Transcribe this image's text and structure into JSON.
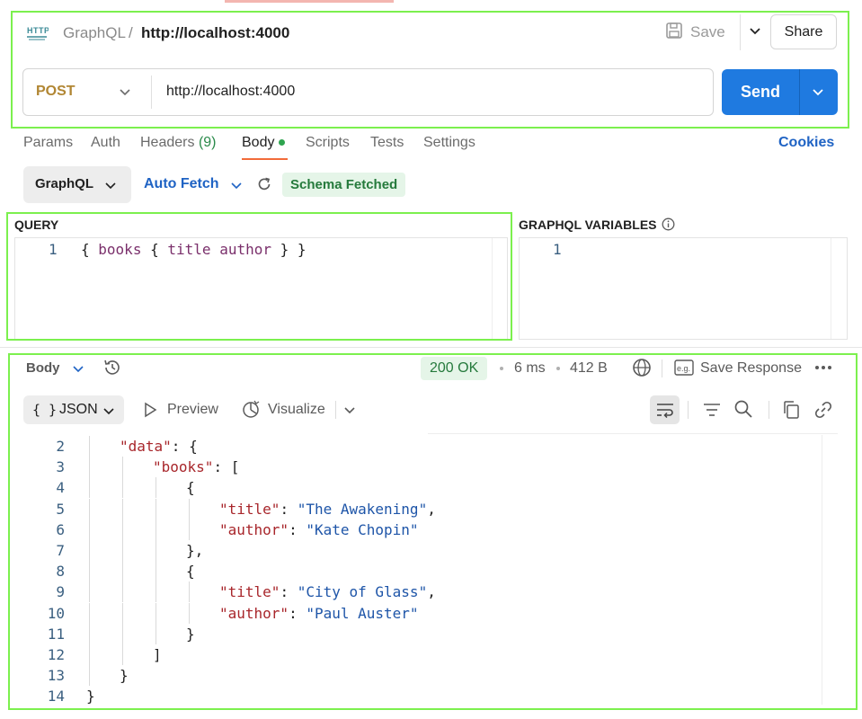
{
  "header": {
    "protocol_badge": "HTTP",
    "breadcrumb_root": "GraphQL",
    "breadcrumb_sep": "/",
    "breadcrumb_current": "http://localhost:4000",
    "save_label": "Save",
    "share_label": "Share"
  },
  "request": {
    "method": "POST",
    "url": "http://localhost:4000",
    "send_label": "Send"
  },
  "tabs": [
    {
      "label": "Params"
    },
    {
      "label": "Auth"
    },
    {
      "label": "Headers",
      "count": "(9)"
    },
    {
      "label": "Body",
      "active": true
    },
    {
      "label": "Scripts"
    },
    {
      "label": "Tests"
    },
    {
      "label": "Settings"
    }
  ],
  "cookies_label": "Cookies",
  "graphql_toolbar": {
    "body_type": "GraphQL",
    "auto_fetch": "Auto Fetch",
    "schema_status": "Schema Fetched"
  },
  "query_pane": {
    "label": "QUERY",
    "line_number": "1",
    "code": "{ books { title author } }"
  },
  "variables_pane": {
    "label": "GRAPHQL VARIABLES",
    "line_number": "1"
  },
  "response": {
    "body_label": "Body",
    "status": "200 OK",
    "time": "6 ms",
    "size": "412 B",
    "save_response": "Save Response",
    "format": "JSON",
    "format_glyph": "{ }",
    "preview_label": "Preview",
    "visualize_label": "Visualize",
    "lines": [
      {
        "n": "2",
        "indent": 1,
        "parts": [
          [
            "key",
            "\"data\""
          ],
          [
            "pun",
            ": {"
          ]
        ]
      },
      {
        "n": "3",
        "indent": 2,
        "parts": [
          [
            "key",
            "\"books\""
          ],
          [
            "pun",
            ": ["
          ]
        ]
      },
      {
        "n": "4",
        "indent": 3,
        "parts": [
          [
            "pun",
            "{"
          ]
        ]
      },
      {
        "n": "5",
        "indent": 4,
        "parts": [
          [
            "key",
            "\"title\""
          ],
          [
            "pun",
            ": "
          ],
          [
            "str",
            "\"The Awakening\""
          ],
          [
            "pun",
            ","
          ]
        ]
      },
      {
        "n": "6",
        "indent": 4,
        "parts": [
          [
            "key",
            "\"author\""
          ],
          [
            "pun",
            ": "
          ],
          [
            "str",
            "\"Kate Chopin\""
          ]
        ]
      },
      {
        "n": "7",
        "indent": 3,
        "parts": [
          [
            "pun",
            "},"
          ]
        ]
      },
      {
        "n": "8",
        "indent": 3,
        "parts": [
          [
            "pun",
            "{"
          ]
        ]
      },
      {
        "n": "9",
        "indent": 4,
        "parts": [
          [
            "key",
            "\"title\""
          ],
          [
            "pun",
            ": "
          ],
          [
            "str",
            "\"City of Glass\""
          ],
          [
            "pun",
            ","
          ]
        ]
      },
      {
        "n": "10",
        "indent": 4,
        "parts": [
          [
            "key",
            "\"author\""
          ],
          [
            "pun",
            ": "
          ],
          [
            "str",
            "\"Paul Auster\""
          ]
        ]
      },
      {
        "n": "11",
        "indent": 3,
        "parts": [
          [
            "pun",
            "}"
          ]
        ]
      },
      {
        "n": "12",
        "indent": 2,
        "parts": [
          [
            "pun",
            "]"
          ]
        ]
      },
      {
        "n": "13",
        "indent": 1,
        "parts": [
          [
            "pun",
            "}"
          ]
        ]
      },
      {
        "n": "14",
        "indent": 0,
        "parts": [
          [
            "pun",
            "}"
          ]
        ]
      }
    ]
  },
  "colors": {
    "accent": "#1f7ae0",
    "method": "#b18633",
    "status_green": "#257a3c",
    "tab_underline": "#f26b3a",
    "highlight_box": "#7cf04e"
  }
}
